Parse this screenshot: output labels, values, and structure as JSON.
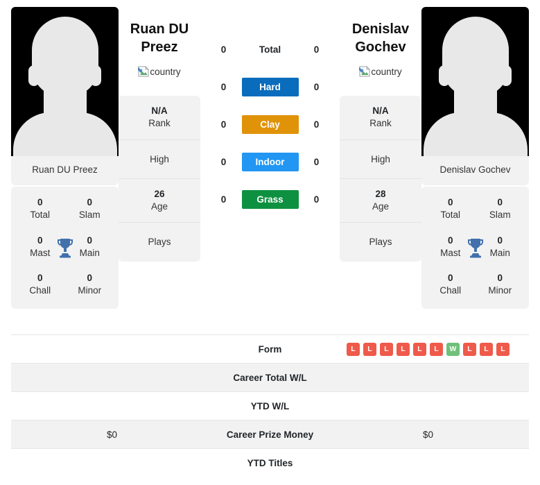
{
  "players": [
    {
      "name_display": "Ruan DU\nPreez",
      "name_line1": "Ruan DU",
      "name_line2": "Preez",
      "caption": "Ruan DU Preez",
      "country_alt": "country",
      "avatar_alt": "player photo",
      "titles": {
        "total": "0",
        "total_label": "Total",
        "slam": "0",
        "slam_label": "Slam",
        "mast": "0",
        "mast_label": "Mast",
        "main": "0",
        "main_label": "Main",
        "chall": "0",
        "chall_label": "Chall",
        "minor": "0",
        "minor_label": "Minor"
      },
      "info": {
        "rank_value": "N/A",
        "rank_label": "Rank",
        "high_value": "",
        "high_label": "High",
        "age_value": "26",
        "age_label": "Age",
        "plays_value": "",
        "plays_label": "Plays"
      },
      "career_total_wl": "",
      "ytd_wl": "",
      "career_prize_money": "$0",
      "ytd_titles": ""
    },
    {
      "name_display": "Denislav\nGochev",
      "name_line1": "Denislav",
      "name_line2": "Gochev",
      "caption": "Denislav Gochev",
      "country_alt": "country",
      "avatar_alt": "player photo",
      "titles": {
        "total": "0",
        "total_label": "Total",
        "slam": "0",
        "slam_label": "Slam",
        "mast": "0",
        "mast_label": "Mast",
        "main": "0",
        "main_label": "Main",
        "chall": "0",
        "chall_label": "Chall",
        "minor": "0",
        "minor_label": "Minor"
      },
      "info": {
        "rank_value": "N/A",
        "rank_label": "Rank",
        "high_value": "",
        "high_label": "High",
        "age_value": "28",
        "age_label": "Age",
        "plays_value": "",
        "plays_label": "Plays"
      },
      "career_total_wl": "",
      "ytd_wl": "",
      "career_prize_money": "$0",
      "ytd_titles": ""
    }
  ],
  "surfaces": [
    {
      "label": "Total",
      "left": "0",
      "right": "0",
      "bg": "transparent",
      "fg": "#212529"
    },
    {
      "label": "Hard",
      "left": "0",
      "right": "0",
      "bg": "#0a6cbc",
      "fg": "#ffffff"
    },
    {
      "label": "Clay",
      "left": "0",
      "right": "0",
      "bg": "#e09309",
      "fg": "#ffffff"
    },
    {
      "label": "Indoor",
      "left": "0",
      "right": "0",
      "bg": "#2196f3",
      "fg": "#ffffff"
    },
    {
      "label": "Grass",
      "left": "0",
      "right": "0",
      "bg": "#0d9140",
      "fg": "#ffffff"
    }
  ],
  "table": {
    "rows": [
      {
        "label": "Form",
        "left": "",
        "right": "",
        "type": "form",
        "shaded": false
      },
      {
        "label": "Career Total W/L",
        "left": "",
        "right": "",
        "type": "text",
        "shaded": true
      },
      {
        "label": "YTD W/L",
        "left": "",
        "right": "",
        "type": "text",
        "shaded": false
      },
      {
        "label": "Career Prize Money",
        "left": "$0",
        "right": "$0",
        "type": "text",
        "shaded": true
      },
      {
        "label": "YTD Titles",
        "left": "",
        "right": "",
        "type": "text",
        "shaded": false
      }
    ]
  },
  "form": {
    "left": [],
    "right": [
      "L",
      "L",
      "L",
      "L",
      "L",
      "L",
      "W",
      "L",
      "L",
      "L"
    ]
  },
  "colors": {
    "win": "#6fc07a",
    "loss": "#ef5a4a",
    "card_bg": "#f2f2f2",
    "trophy": "#4170ac",
    "row_shaded": "#f2f2f2",
    "border": "#e6e6e6"
  }
}
